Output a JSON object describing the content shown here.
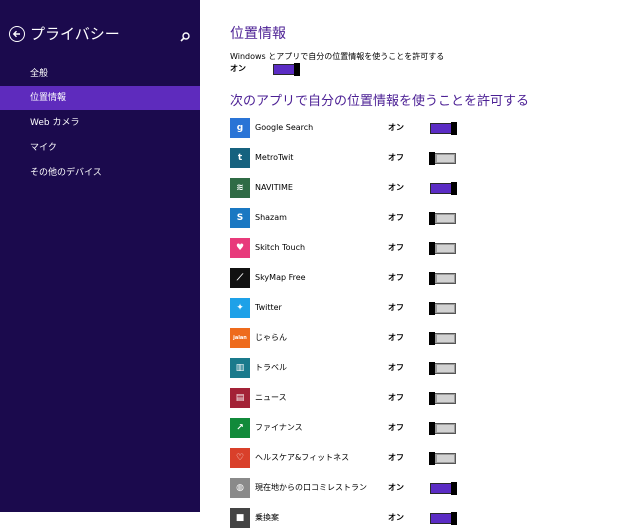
{
  "sidebar": {
    "title": "プライバシー",
    "items": [
      {
        "label": "全般",
        "active": false
      },
      {
        "label": "位置情報",
        "active": true
      },
      {
        "label": "Web カメラ",
        "active": false
      },
      {
        "label": "マイク",
        "active": false
      },
      {
        "label": "その他のデバイス",
        "active": false
      }
    ]
  },
  "location": {
    "title": "位置情報",
    "master_label": "Windows とアプリで自分の位置情報を使うことを許可する",
    "master_state": "オン",
    "master_on": true,
    "apps_title": "次のアプリで自分の位置情報を使うことを許可する"
  },
  "apps": [
    {
      "name": "Google Search",
      "state": "オン",
      "on": true,
      "icon": "google-search-icon",
      "color": "#2a74d6",
      "glyph": "g"
    },
    {
      "name": "MetroTwit",
      "state": "オフ",
      "on": false,
      "icon": "metrotwit-icon",
      "color": "#16627f",
      "glyph": "t"
    },
    {
      "name": "NAVITIME",
      "state": "オン",
      "on": true,
      "icon": "navitime-icon",
      "color": "#2f6b45",
      "glyph": "≋"
    },
    {
      "name": "Shazam",
      "state": "オフ",
      "on": false,
      "icon": "shazam-icon",
      "color": "#1a78c2",
      "glyph": "S"
    },
    {
      "name": "Skitch Touch",
      "state": "オフ",
      "on": false,
      "icon": "skitch-touch-icon",
      "color": "#e83a7b",
      "glyph": "♥"
    },
    {
      "name": "SkyMap Free",
      "state": "オフ",
      "on": false,
      "icon": "skymap-free-icon",
      "color": "#111111",
      "glyph": "⟋"
    },
    {
      "name": "Twitter",
      "state": "オフ",
      "on": false,
      "icon": "twitter-icon",
      "color": "#1ea1e8",
      "glyph": "✦"
    },
    {
      "name": "じゃらん",
      "state": "オフ",
      "on": false,
      "icon": "jalan-icon",
      "color": "#ee6b1d",
      "glyph": "jalan"
    },
    {
      "name": "トラベル",
      "state": "オフ",
      "on": false,
      "icon": "travel-icon",
      "color": "#1a7a8c",
      "glyph": "▥"
    },
    {
      "name": "ニュース",
      "state": "オフ",
      "on": false,
      "icon": "news-icon",
      "color": "#a32236",
      "glyph": "▤"
    },
    {
      "name": "ファイナンス",
      "state": "オフ",
      "on": false,
      "icon": "finance-icon",
      "color": "#118a3b",
      "glyph": "↗"
    },
    {
      "name": "ヘルスケア&フィットネス",
      "state": "オフ",
      "on": false,
      "icon": "health-fitness-icon",
      "color": "#d9402a",
      "glyph": "♡"
    },
    {
      "name": "現在地からの口コミレストラン",
      "state": "オン",
      "on": true,
      "icon": "restaurant-reviews-icon",
      "color": "#8a8a8a",
      "glyph": "◍"
    },
    {
      "name": "乗換案",
      "state": "オン",
      "on": true,
      "icon": "transit-icon",
      "color": "#444444",
      "glyph": "■"
    }
  ],
  "colors": {
    "sidebar_bg": "#1b0a4d",
    "sidebar_active": "#5e2bbd",
    "accent": "#4b1f94",
    "toggle_on": "#5b2cc4"
  }
}
